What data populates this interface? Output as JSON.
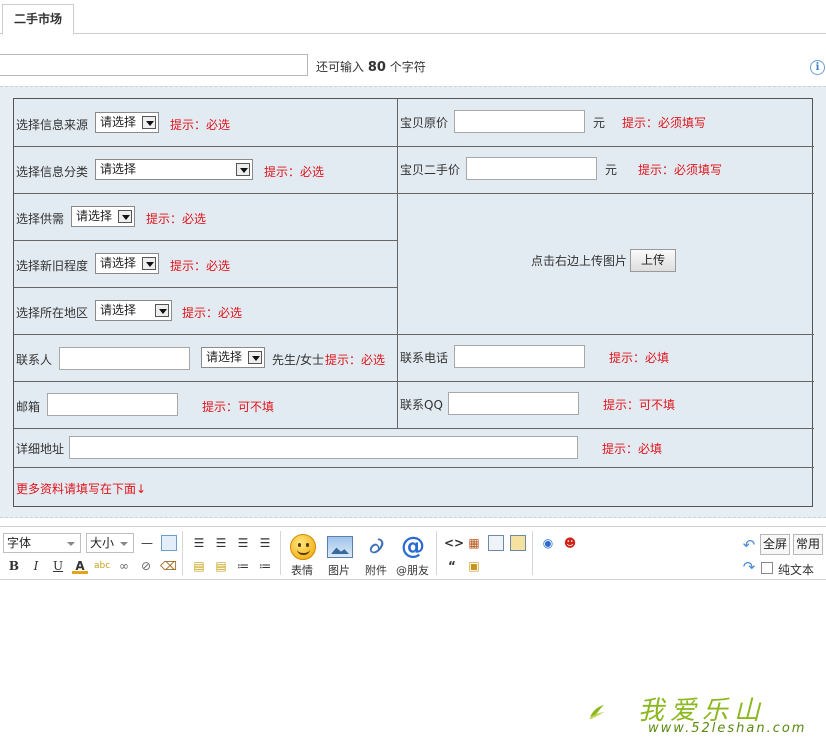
{
  "tab": {
    "label": "二手市场"
  },
  "title_row": {
    "prefix": "还可输入",
    "count": "80",
    "suffix": "个字符"
  },
  "form": {
    "source": {
      "label": "选择信息来源",
      "select": "请选择",
      "hint": "提示：必选"
    },
    "orig_price": {
      "label": "宝贝原价",
      "unit": "元",
      "hint": "提示：必须填写"
    },
    "category": {
      "label": "选择信息分类",
      "select": "请选择",
      "hint": "提示：必选"
    },
    "used_price": {
      "label": "宝贝二手价",
      "unit": "元",
      "hint": "提示：必须填写"
    },
    "supply": {
      "label": "选择供需",
      "select": "请选择",
      "hint": "提示：必选"
    },
    "condition": {
      "label": "选择新旧程度",
      "select": "请选择",
      "hint": "提示：必选"
    },
    "region": {
      "label": "选择所在地区",
      "select": "请选择",
      "hint": "提示：必选"
    },
    "upload": {
      "label": "点击右边上传图片",
      "button": "上传"
    },
    "contact": {
      "label": "联系人",
      "select": "请选择",
      "suffix": "先生/女士",
      "hint": "提示：必选"
    },
    "phone": {
      "label": "联系电话",
      "hint": "提示：必填"
    },
    "email": {
      "label": "邮箱",
      "hint": "提示：可不填"
    },
    "qq": {
      "label": "联系QQ",
      "hint": "提示：可不填"
    },
    "address": {
      "label": "详细地址",
      "hint": "提示：必填"
    },
    "more": "更多资料请填写在下面↓"
  },
  "editor": {
    "font": "字体",
    "size": "大小",
    "emoji": "表情",
    "image": "图片",
    "attach": "附件",
    "mention": "@朋友",
    "fullscreen": "全屏",
    "common": "常用",
    "plaintext": "纯文本"
  },
  "watermark": {
    "text": "我爱乐山",
    "url": "www.52leshan.com"
  },
  "colors": {
    "hint": "#e0141b",
    "form_bg": "#e3ebf2",
    "watermark": "#8bb81e"
  }
}
